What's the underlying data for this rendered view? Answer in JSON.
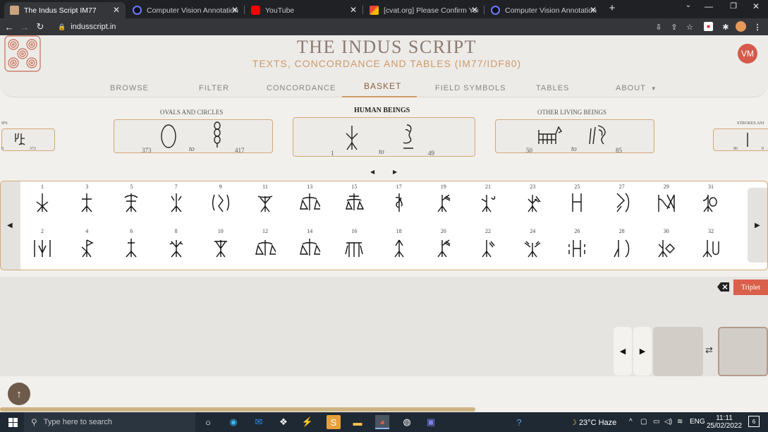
{
  "browser": {
    "tabs": [
      {
        "title": "The Indus Script IM77",
        "active": true
      },
      {
        "title": "Computer Vision Annotation Too",
        "active": false
      },
      {
        "title": "YouTube",
        "active": false
      },
      {
        "title": "[cvat.org] Please Confirm Your E",
        "active": false
      },
      {
        "title": "Computer Vision Annotation Too",
        "active": false
      }
    ],
    "url": "indusscript.in"
  },
  "site": {
    "title": "THE INDUS SCRIPT",
    "subtitle": "TEXTS, CONCORDANCE AND TABLES (IM77/IDF80)",
    "avatar": "VM"
  },
  "nav": [
    "BROWSE",
    "FILTER",
    "CONCORDANCE",
    "BASKET",
    "FIELD SYMBOLS",
    "TABLES",
    "ABOUT"
  ],
  "nav_active": "BASKET",
  "categories": [
    {
      "name": "IPS",
      "from": "0",
      "to": "372"
    },
    {
      "name": "OVALS AND CIRCLES",
      "from": "373",
      "to": "417",
      "sep": "to"
    },
    {
      "name": "HUMAN BEINGS",
      "from": "1",
      "to": "49",
      "sep": "to"
    },
    {
      "name": "OTHER LIVING BEINGS",
      "from": "50",
      "to": "85",
      "sep": "to"
    },
    {
      "name": "STROKES ANI",
      "from": "86",
      "to": "0"
    }
  ],
  "signs_top": [
    "1",
    "3",
    "5",
    "7",
    "9",
    "11",
    "13",
    "15",
    "17",
    "19",
    "21",
    "23",
    "25",
    "27",
    "29",
    "31"
  ],
  "signs_bottom": [
    "2",
    "4",
    "6",
    "8",
    "10",
    "12",
    "14",
    "16",
    "18",
    "20",
    "22",
    "24",
    "26",
    "28",
    "30",
    "32"
  ],
  "basket": {
    "triplet_label": "Triplet"
  },
  "taskbar": {
    "search_placeholder": "Type here to search",
    "weather": "23°C Haze",
    "lang": "ENG",
    "time": "11:11",
    "date": "25/02/2022",
    "notifications": "6"
  },
  "colors": {
    "accent": "#d09a6a",
    "brand_red": "#d65a4a",
    "triplet": "#d9604a"
  }
}
